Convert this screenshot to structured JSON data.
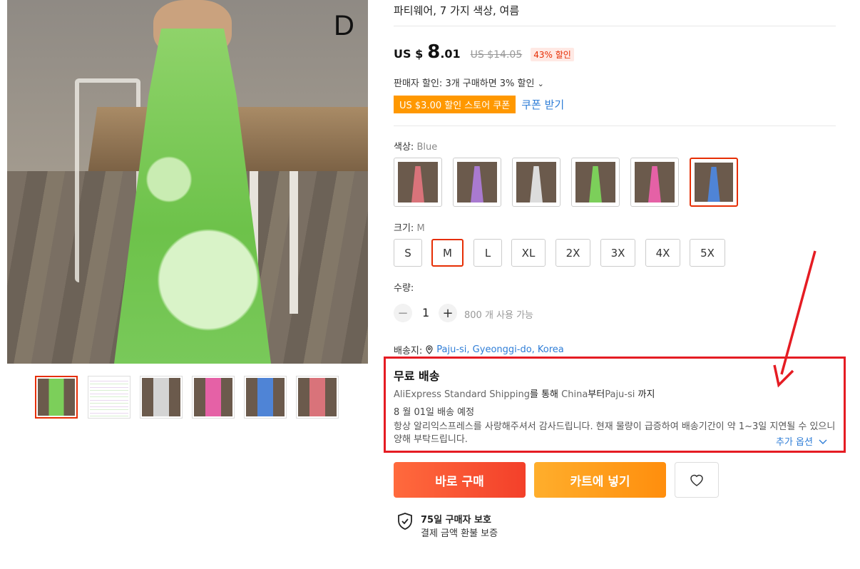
{
  "image_overlay_letter": "D",
  "product": {
    "title_tail": "파티웨어, 7 가지 색상, 여름",
    "price": {
      "currency": "US $",
      "whole": "8",
      "fraction": ".01",
      "original": "US $14.05",
      "discount_badge": "43% 할인"
    },
    "seller_discount": "판매자 할인: 3개 구매하면 3% 할인",
    "coupon": {
      "label": "US $3.00 할인 스토어 쿠폰",
      "link": "쿠폰 받기"
    }
  },
  "color": {
    "label": "색상:",
    "selected": "Blue",
    "swatches": [
      {
        "name": "pink-red",
        "color": "#d9737a"
      },
      {
        "name": "purple",
        "color": "#a97ad0"
      },
      {
        "name": "white",
        "color": "#dcdcdc"
      },
      {
        "name": "green",
        "color": "#7ccf5a"
      },
      {
        "name": "pink",
        "color": "#e561a6"
      },
      {
        "name": "blue",
        "color": "#4f84d6"
      }
    ]
  },
  "size": {
    "label": "크기:",
    "selected": "M",
    "options": [
      "S",
      "M",
      "L",
      "XL",
      "2X",
      "3X",
      "4X",
      "5X"
    ]
  },
  "quantity": {
    "label": "수량:",
    "value": "1",
    "available": "800 개 사용 가능"
  },
  "shipping": {
    "ship_to_label": "배송지:",
    "location": "Paju-si, Gyeonggi-do, Korea",
    "title": "무료 배송",
    "method_prefix": "AliExpress Standard Shipping",
    "method_mid": "를 통해 ",
    "origin": "China",
    "method_suffix": "부터",
    "destination": "Paju-si",
    "method_end": " 까지",
    "eta": "8 월 01일 배송 예정",
    "note": "항상 알리익스프레스를 사랑해주셔서 감사드립니다. 현재 물량이 급증하여 배송기간이 약 1~3일 지연될 수 있으니 양해 부탁드립니다.",
    "more_options": "추가 옵션"
  },
  "actions": {
    "buy_now": "바로 구매",
    "add_to_cart": "카트에 넣기"
  },
  "protection": {
    "title": "75일 구매자 보호",
    "subtitle": "결제 금액 환불 보증"
  },
  "thumbnails": [
    {
      "name": "green",
      "color": "#7ccf5a"
    },
    {
      "name": "size-chart",
      "color": "#f4f4f4"
    },
    {
      "name": "white",
      "color": "#d4d4d4"
    },
    {
      "name": "pink",
      "color": "#e561a6"
    },
    {
      "name": "blue",
      "color": "#4f84d6"
    },
    {
      "name": "pink-red",
      "color": "#d9737a"
    }
  ],
  "accent_color": "#e62e04",
  "annotation_color": "#e51c23"
}
